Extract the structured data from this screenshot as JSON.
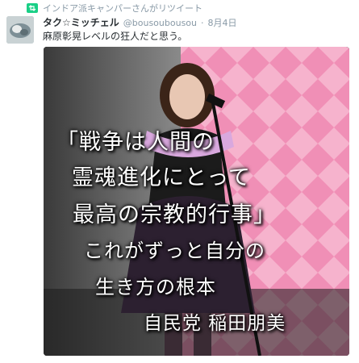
{
  "retweet": {
    "text": "インドア派キャンパーさんがリツイート",
    "icon": "retweet-icon"
  },
  "tweet": {
    "display_name": "タク☆ミッチェル",
    "screen_name": "@bousoubousou",
    "separator": "·",
    "timestamp": "8月4日",
    "text": "麻原彰晃レベルの狂人だと思う。"
  },
  "image_overlay": {
    "line1": "「戦争は人間の",
    "line2": "霊魂進化にとって",
    "line3": "最高の宗教的行事」",
    "line4": "これがずっと自分の",
    "line5": "生き方の根本",
    "line6": "自民党 稲田朋美"
  },
  "colors": {
    "retweet_green": "#19cf86",
    "muted_text": "#8899a6",
    "text": "#292f33",
    "backdrop_pink": "#f4a6c4"
  }
}
